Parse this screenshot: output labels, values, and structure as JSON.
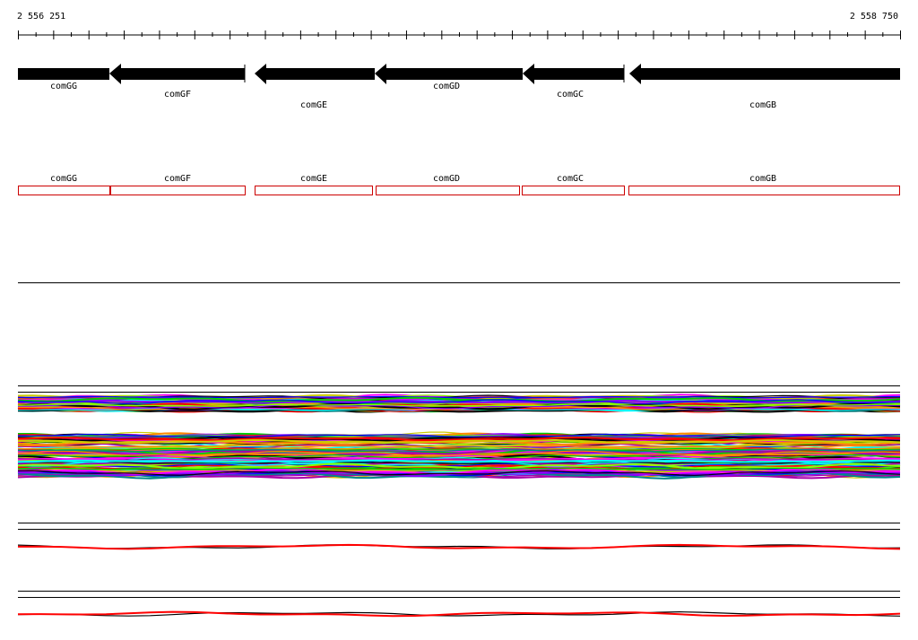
{
  "coordinates": {
    "start": "2 556 251",
    "end": "2 558 750"
  },
  "genes": [
    {
      "name": "comGG"
    },
    {
      "name": "comGF"
    },
    {
      "name": "comGE"
    },
    {
      "name": "comGD"
    },
    {
      "name": "comGC"
    },
    {
      "name": "comGB"
    }
  ],
  "colors": {
    "gene_arrow": "#000000",
    "annotation_box": "#cc0000",
    "track_line": "#000000",
    "signal_line": "#ff0000"
  },
  "profile_palette": [
    "#ff00ff",
    "#00cc00",
    "#0000ff",
    "#00ffff",
    "#ff0000",
    "#cccc00",
    "#ff8800",
    "#000000",
    "#8800ff",
    "#88ff00",
    "#aa00aa",
    "#008888"
  ]
}
